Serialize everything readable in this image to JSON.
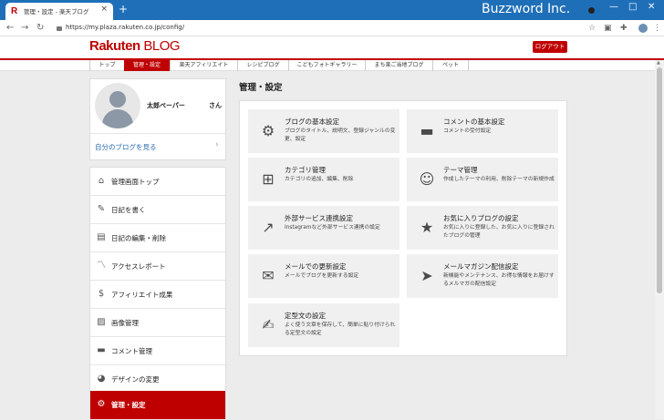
{
  "browser": {
    "tab_title": "管理・設定 - 楽天ブログ",
    "tab_close": "×",
    "new_tab": "+",
    "url": "https://my.plaza.rakuten.co.jp/config/",
    "watermark": "Buzzword Inc.",
    "window_controls": [
      "—",
      "□",
      "✕"
    ]
  },
  "header": {
    "logo_main": "Rakuten",
    "logo_sub": "BLOG",
    "logout_label": "ログアウト"
  },
  "subnav": [
    {
      "label": "トップ",
      "active": false
    },
    {
      "label": "管理・設定",
      "active": true
    },
    {
      "label": "楽天アフィリエイト",
      "active": false
    },
    {
      "label": "レシピブログ",
      "active": false
    },
    {
      "label": "こどもフォトギャラリー",
      "active": false
    },
    {
      "label": "まち楽ご当地ブログ",
      "active": false
    },
    {
      "label": "ペット",
      "active": false
    }
  ],
  "profile": {
    "name": "太郎ペーパー",
    "suffix": "さん",
    "link": "自分のブログを見る",
    "chevron": "›"
  },
  "menu": [
    {
      "label": "管理画面トップ",
      "icon": "home-icon"
    },
    {
      "label": "日記を書く",
      "icon": "pencil-icon"
    },
    {
      "label": "日記の編集・削除",
      "icon": "document-icon"
    },
    {
      "label": "アクセスレポート",
      "icon": "trend-chart-icon"
    },
    {
      "label": "アフィリエイト成果",
      "icon": "money-bag-icon"
    },
    {
      "label": "画像管理",
      "icon": "image-icon"
    },
    {
      "label": "コメント管理",
      "icon": "comment-icon"
    },
    {
      "label": "デザインの変更",
      "icon": "palette-icon"
    },
    {
      "label": "管理・設定",
      "icon": "gear-icon",
      "active": true
    }
  ],
  "main": {
    "title": "管理・設定",
    "tiles": [
      {
        "title": "ブログの基本設定",
        "desc": "ブログのタイトル、説明文、登録ジャンルの変更、設定",
        "icon": "gear-icon"
      },
      {
        "title": "コメントの基本設定",
        "desc": "コメントの受付設定",
        "icon": "comment-icon"
      },
      {
        "title": "カテゴリ管理",
        "desc": "カテゴリの追加、編集、削除",
        "icon": "hierarchy-icon"
      },
      {
        "title": "テーマ管理",
        "desc": "作成したテーマの利用、削除テーマの新規作成",
        "icon": "users-icon"
      },
      {
        "title": "外部サービス連携設定",
        "desc": "Instagramなど外部サービス連携の設定",
        "icon": "share-icon"
      },
      {
        "title": "お気に入りブログの設定",
        "desc": "お気に入りに登録した、お気に入りに登録されたブログの管理",
        "icon": "star-icon"
      },
      {
        "title": "メールでの更新設定",
        "desc": "メールでブログを更新する設定",
        "icon": "mail-user-icon"
      },
      {
        "title": "メールマガジン配信設定",
        "desc": "新機能やメンテナンス、お得な情報をお届けするメルマガの配信設定",
        "icon": "paper-plane-icon"
      },
      {
        "title": "定型文の設定",
        "desc": "よく使う文章を保存して、簡単に貼り付けられる定型文の設定",
        "icon": "edit-document-icon"
      }
    ]
  }
}
